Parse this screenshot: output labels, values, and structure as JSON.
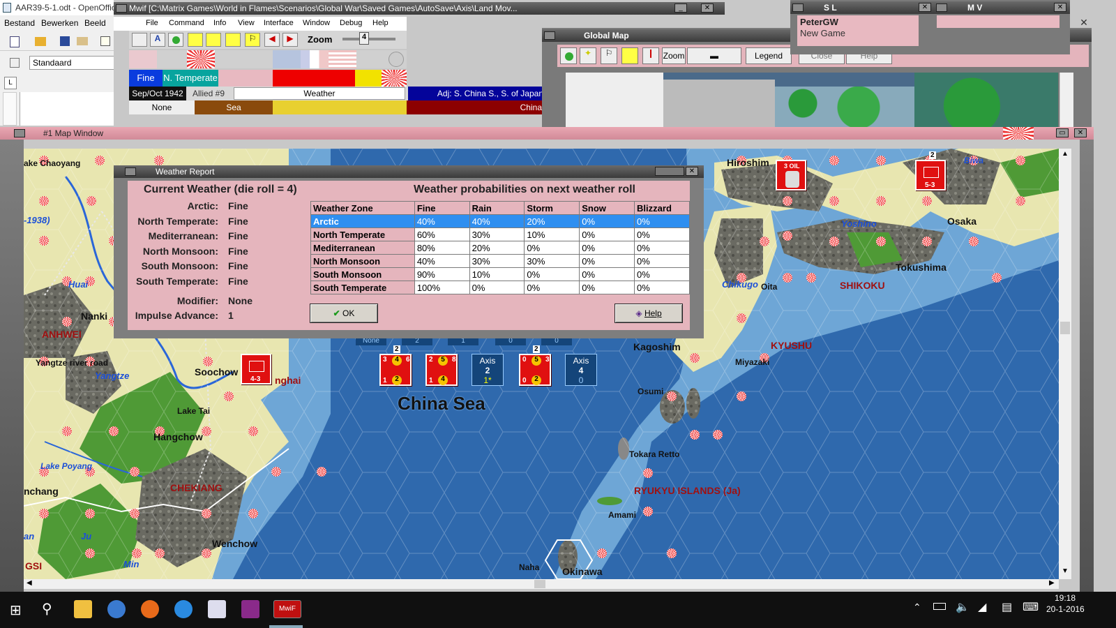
{
  "openoffice": {
    "title": "AAR39-5-1.odt - OpenOffic",
    "menu": [
      "Bestand",
      "Bewerken",
      "Beeld"
    ],
    "style_value": "Standaard",
    "ruler_mark": "L"
  },
  "mwif": {
    "title": "Mwif [C:\\Matrix Games\\World in Flames\\Scenarios\\Global War\\Saved Games\\AutoSave\\Axis\\Land Mov...",
    "menu": [
      "File",
      "Command",
      "Info",
      "View",
      "Interface",
      "Window",
      "Debug",
      "Help"
    ],
    "zoom_label": "Zoom",
    "zoom_value": "4",
    "weather_now": "Fine",
    "zone_now": "N. Temperate",
    "date": "Sep/Oct 1942",
    "impulse": "Allied #9",
    "weather_field": "Weather",
    "adjacent": "Adj: S. China S., S. of Japan",
    "row3_left": "None",
    "row3_mid": "Sea",
    "row3_right": "China"
  },
  "global_map": {
    "title": "Global Map",
    "zoom_label": "Zoom",
    "legend_label": "Legend",
    "close_label": "Close",
    "help_label": "Help"
  },
  "player_sl": {
    "title": "S L",
    "name": "PeterGW",
    "status": "New Game"
  },
  "player_mv": {
    "title": "M V"
  },
  "map_window": {
    "title": "#1 Map Window"
  },
  "map": {
    "cities": [
      "ake Chaoyang",
      "Nanki",
      "Soochow",
      "Lake Tai",
      "Hangchow",
      "nchang",
      "Wenchow",
      "Hiroshim",
      "Osaka",
      "Tokushima",
      "Oita",
      "Kagoshim",
      "Miyazaki",
      "Osumi",
      "Tokara Retto",
      "Amami",
      "Naha",
      "Okinawa",
      "Lake Poyang"
    ],
    "provinces": [
      "ANHWEI",
      "CHEKIANG",
      "SHIKOKU",
      "KYUSHU",
      "RYUKYU ISLANDS (Ja)",
      "nghai",
      "GSI"
    ],
    "water": [
      "Huai",
      "Yangtze",
      "Yoshino",
      "Chikugo",
      "Biwa",
      "-1938)",
      "Min",
      "an",
      "Ju"
    ],
    "road_label": "Yangtze river road",
    "sea_name": "China Sea",
    "units": [
      {
        "top": "3",
        "mid": "4",
        "left": "1",
        "right": "6",
        "bottom": "2",
        "stack": "2"
      },
      {
        "top": "2",
        "mid": "5",
        "left": "1",
        "right": "8",
        "bottom": "4",
        "stack": ""
      },
      {
        "top": "0",
        "mid": "5",
        "left": "0",
        "right": "3",
        "bottom": "2",
        "stack": "2"
      }
    ],
    "axis_stacks": [
      {
        "label": "Axis",
        "value": "2",
        "extra": "1*"
      },
      {
        "label": "Axis",
        "value": "4",
        "extra": "0"
      }
    ],
    "hidden_row": [
      "None",
      "2",
      "1",
      "0",
      "0"
    ],
    "japan_unit_stacks": [
      "2"
    ],
    "oil_label": "3 OIL",
    "japan_unit_value": "5-3",
    "china_unit_value": "4-3"
  },
  "weather_report": {
    "title": "Weather Report",
    "heading_left": "Current Weather (die roll = 4)",
    "heading_right": "Weather probabilities on next weather roll",
    "current": [
      {
        "zone": "Arctic:",
        "value": "Fine"
      },
      {
        "zone": "North Temperate:",
        "value": "Fine"
      },
      {
        "zone": "Mediterranean:",
        "value": "Fine"
      },
      {
        "zone": "North Monsoon:",
        "value": "Fine"
      },
      {
        "zone": "South Monsoon:",
        "value": "Fine"
      },
      {
        "zone": "South Temperate:",
        "value": "Fine"
      }
    ],
    "modifier_label": "Modifier:",
    "modifier_value": "None",
    "impulse_label": "Impulse Advance:",
    "impulse_value": "1",
    "columns": [
      "Weather Zone",
      "Fine",
      "Rain",
      "Storm",
      "Snow",
      "Blizzard"
    ],
    "rows": [
      {
        "zone": "Arctic",
        "values": [
          "40%",
          "40%",
          "20%",
          "0%",
          "0%"
        ]
      },
      {
        "zone": "North Temperate",
        "values": [
          "60%",
          "30%",
          "10%",
          "0%",
          "0%"
        ]
      },
      {
        "zone": "Mediterranean",
        "values": [
          "80%",
          "20%",
          "0%",
          "0%",
          "0%"
        ]
      },
      {
        "zone": "North Monsoon",
        "values": [
          "40%",
          "30%",
          "30%",
          "0%",
          "0%"
        ]
      },
      {
        "zone": "South Monsoon",
        "values": [
          "90%",
          "10%",
          "0%",
          "0%",
          "0%"
        ]
      },
      {
        "zone": "South Temperate",
        "values": [
          "100%",
          "0%",
          "0%",
          "0%",
          "0%"
        ]
      }
    ],
    "ok_label": "OK",
    "help_label": "Help"
  },
  "taskbar": {
    "time": "19:18",
    "date": "20-1-2016"
  },
  "colors": {
    "pink": "#e5b5bd",
    "selected_row": "#2f8ff0",
    "unit_red": "#e01010",
    "sea": "#2f69ad"
  }
}
